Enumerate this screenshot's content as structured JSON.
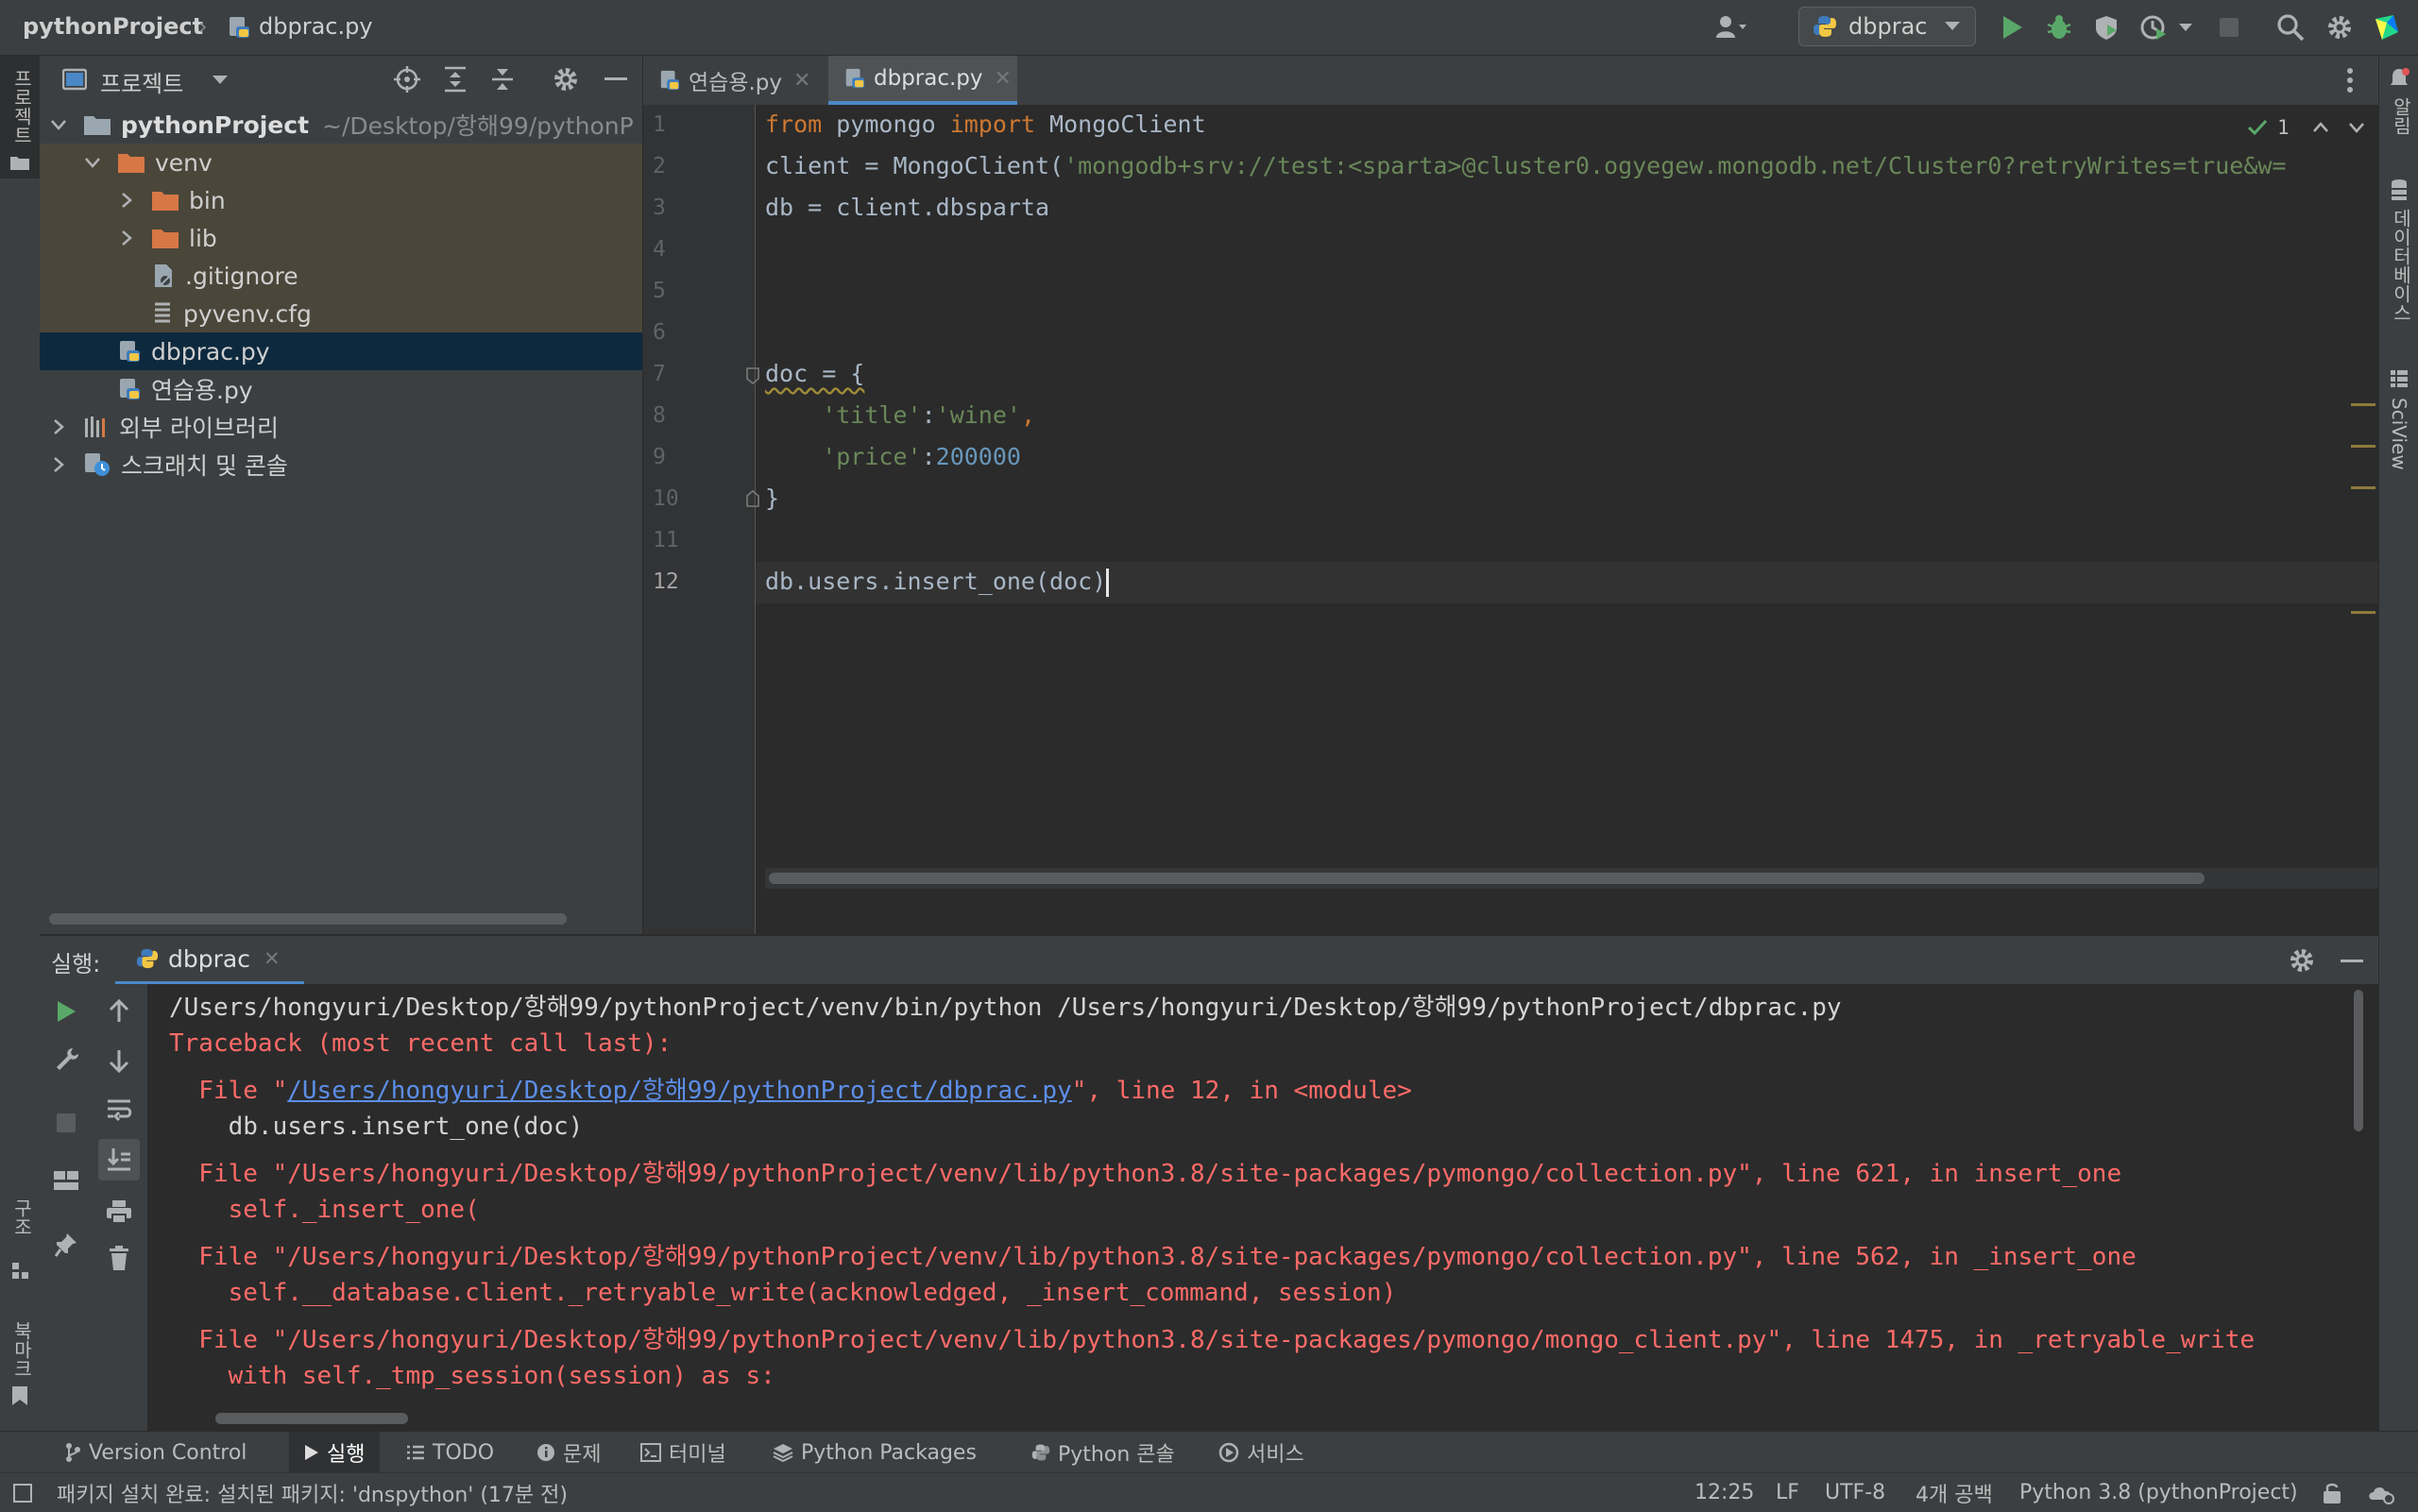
{
  "titlebar": {
    "project": "pythonProject",
    "file": "dbprac.py",
    "run_config": "dbprac"
  },
  "left_strip": {
    "project_label": "프로젝트",
    "structure_label": "구조",
    "bookmarks_label": "북마크"
  },
  "right_strip": {
    "notifications_label": "알림",
    "database_label": "데이터베이스",
    "sciview_label": "SciView"
  },
  "project_panel": {
    "title": "프로젝트",
    "tree": {
      "root_name": "pythonProject",
      "root_path": "~/Desktop/항해99/pythonP",
      "venv": "venv",
      "bin": "bin",
      "lib": "lib",
      "gitignore": ".gitignore",
      "pyvenv": "pyvenv.cfg",
      "dbprac": "dbprac.py",
      "practice": "연습용.py",
      "external_libs": "외부 라이브러리",
      "scratches": "스크래치 및 콘솔"
    }
  },
  "editor": {
    "tabs": [
      {
        "label": "연습용.py"
      },
      {
        "label": "dbprac.py"
      }
    ],
    "inspection_count": "1",
    "line_numbers": [
      "1",
      "2",
      "3",
      "4",
      "5",
      "6",
      "7",
      "8",
      "9",
      "10",
      "11",
      "12"
    ],
    "code": {
      "l1_kw1": "from",
      "l1_mod": " pymongo ",
      "l1_kw2": "import",
      "l1_rest": " MongoClient",
      "l2_start": "client = MongoClient(",
      "l2_str": "'mongodb+srv://test:<sparta>@cluster0.ogyegew.mongodb.net/Cluster0?retryWrites=true&w=",
      "l3": "db = client.dbsparta",
      "l7": "doc = {",
      "l8_key": "    'title'",
      "l8_colon": ":",
      "l8_val": "'wine'",
      "l8_comma": ",",
      "l9_key": "    'price'",
      "l9_colon": ":",
      "l9_val": "200000",
      "l10": "}",
      "l12": "db.users.insert_one(doc)"
    }
  },
  "run": {
    "label": "실행:",
    "tab": "dbprac",
    "output": {
      "cmd": "/Users/hongyuri/Desktop/항해99/pythonProject/venv/bin/python /Users/hongyuri/Desktop/항해99/pythonProject/dbprac.py",
      "traceback": "Traceback (most recent call last):",
      "f1_pre": "  File \"",
      "f1_link": "/Users/hongyuri/Desktop/항해99/pythonProject/dbprac.py",
      "f1_post": "\", line 12, in <module>",
      "c1": "    db.users.insert_one(doc)",
      "f2": "  File \"/Users/hongyuri/Desktop/항해99/pythonProject/venv/lib/python3.8/site-packages/pymongo/collection.py\", line 621, in insert_one",
      "c2": "    self._insert_one(",
      "f3": "  File \"/Users/hongyuri/Desktop/항해99/pythonProject/venv/lib/python3.8/site-packages/pymongo/collection.py\", line 562, in _insert_one",
      "c3": "    self.__database.client._retryable_write(acknowledged, _insert_command, session)",
      "f4": "  File \"/Users/hongyuri/Desktop/항해99/pythonProject/venv/lib/python3.8/site-packages/pymongo/mongo_client.py\", line 1475, in _retryable_write",
      "c4": "    with self._tmp_session(session) as s:"
    }
  },
  "bottom_tabs": {
    "version_control": "Version Control",
    "run": "실행",
    "todo": "TODO",
    "problems": "문제",
    "terminal": "터미널",
    "python_packages": "Python Packages",
    "python_console": "Python 콘솔",
    "services": "서비스"
  },
  "status": {
    "message": "패키지 설치 완료: 설치된 패키지: 'dnspython' (17분 전)",
    "position": "12:25",
    "line_sep": "LF",
    "encoding": "UTF-8",
    "indent": "4개 공백",
    "interpreter": "Python 3.8 (pythonProject)"
  },
  "colors": {
    "accent": "#4a88c7",
    "keyword": "#cc7832",
    "string": "#6a8759",
    "number": "#6897bb",
    "error": "#ff6b68",
    "run_green": "#59a869"
  }
}
